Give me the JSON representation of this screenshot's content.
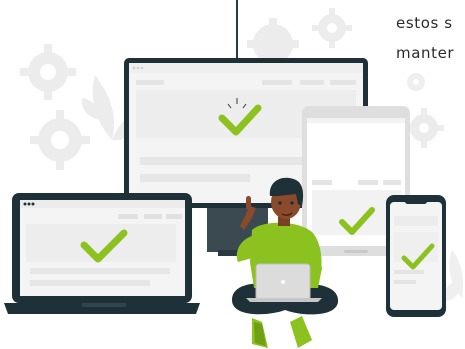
{
  "caption": {
    "line1": "estos s",
    "line2": "manter"
  },
  "colors": {
    "accent_green": "#8cc21f",
    "device_dark": "#1f3138",
    "screen_light": "#f4f4f4",
    "placeholder_gray": "#e4e4e4",
    "gear_gray": "#ececec",
    "skin": "#8a4a2c"
  },
  "icons": {
    "check": "checkmark-icon",
    "gear": "gear-icon",
    "plant": "plant-icon"
  }
}
